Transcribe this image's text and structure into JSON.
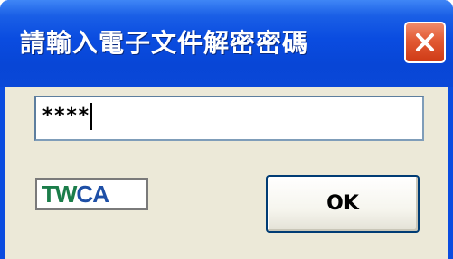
{
  "dialog": {
    "title": "請輸入電子文件解密密碼"
  },
  "password": {
    "value": "****"
  },
  "logo": {
    "text_tw": "TW",
    "text_ca": "CA"
  },
  "buttons": {
    "ok_label": "OK"
  },
  "icons": {
    "close": "close-icon"
  },
  "colors": {
    "titlebar": "#0a4ce0",
    "close_button": "#e25a34",
    "client_background": "#ece9d8",
    "logo_green": "#1b7d4a",
    "logo_blue": "#1e4fa6"
  }
}
